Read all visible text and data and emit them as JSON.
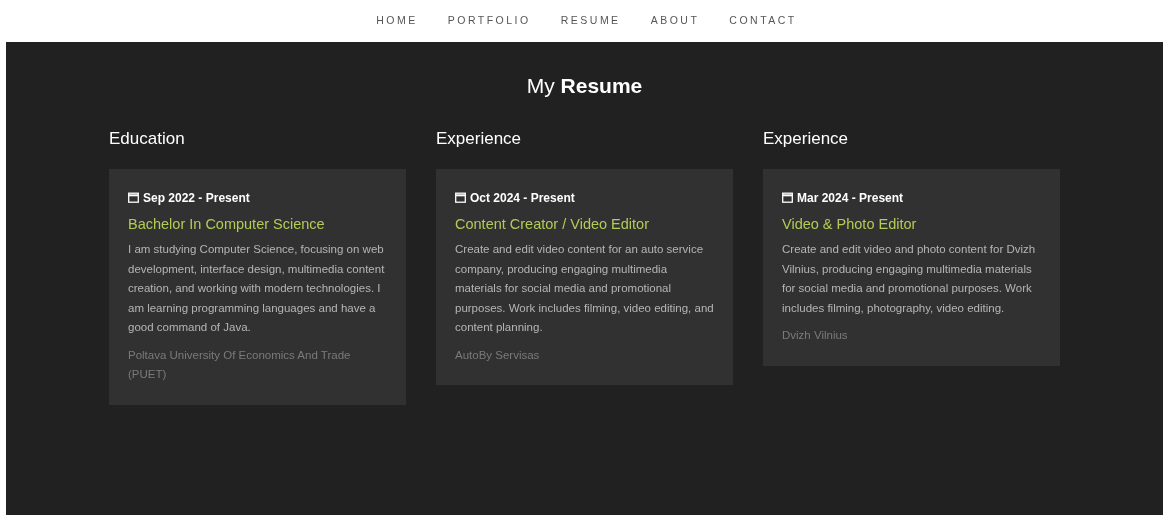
{
  "nav": [
    "HOME",
    "PORTFOLIO",
    "RESUME",
    "ABOUT",
    "CONTACT"
  ],
  "title": "My **Resume**",
  "columns": [
    {
      "heading": "Education",
      "card": {
        "date": "Sep 2022 - Present",
        "role": "Bachelor In Computer Science",
        "description": "I am studying Computer Science, focusing on web development, interface design, multimedia content creation, and working with modern technologies. I am learning programming languages and have a good command of Java.",
        "place": "Poltava University Of Economics And Trade (PUET)"
      }
    },
    {
      "heading": "Experience",
      "card": {
        "date": "Oct 2024 - Present",
        "role": "Content Creator / Video Editor",
        "description": "Create and edit video content for an auto service company, producing engaging multimedia materials for social media and promotional purposes. Work includes filming, video editing, and content planning.",
        "place": "AutoBy Servisas"
      }
    },
    {
      "heading": "Experience",
      "card": {
        "date": "Mar 2024 - Present",
        "role": "Video & Photo Editor",
        "description": "Create and edit video and photo content for Dvizh Vilnius, producing engaging multimedia materials for social media and promotional purposes. Work includes filming, photography, video editing.",
        "place": "Dvizh Vilnius"
      }
    }
  ]
}
